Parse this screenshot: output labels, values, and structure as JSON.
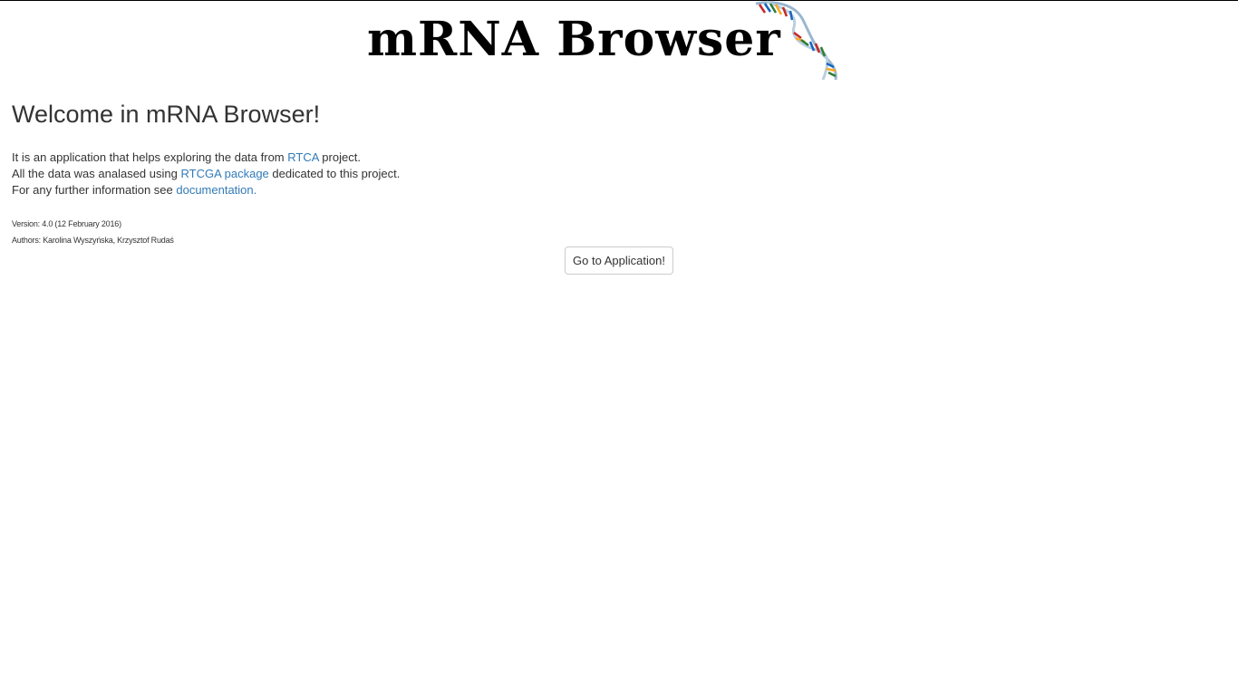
{
  "header": {
    "logo_text": "mRNA Browser",
    "logo_icon": "dna-helix-icon"
  },
  "main": {
    "heading": "Welcome in mRNA Browser!",
    "intro": {
      "line1_prefix": "It is an application that helps exploring the data from ",
      "line1_link": "RTCA",
      "line1_suffix": " project.",
      "line2_prefix": "All the data was analased using ",
      "line2_link": "RTCGA package",
      "line2_suffix": " dedicated to this project.",
      "line3_prefix": "For any further information see ",
      "line3_link": "documentation."
    },
    "version": "Version: 4.0 (12 February 2016)",
    "authors": "Authors: Karolina Wyszyńska, Krzysztof Rudaś",
    "go_button_label": "Go to Application!"
  },
  "colors": {
    "link": "#337ab7",
    "text": "#333333",
    "logo": "#000000"
  }
}
